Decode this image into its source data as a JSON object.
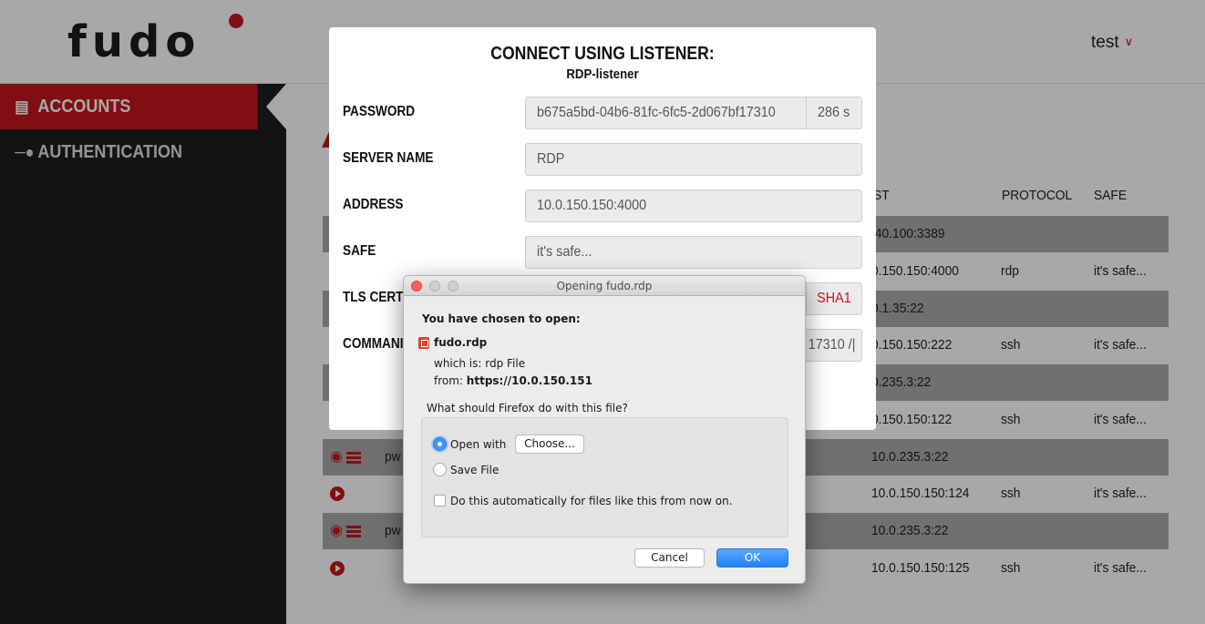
{
  "header": {
    "logo": "fudo",
    "user": "test"
  },
  "sidebar": {
    "items": [
      {
        "label": "ACCOUNTS",
        "active": true
      },
      {
        "label": "AUTHENTICATION",
        "active": false
      }
    ]
  },
  "table": {
    "headers": {
      "address": "ST",
      "protocol": "PROTOCOL",
      "safe": "SAFE"
    },
    "rows": [
      {
        "name": "",
        "address": ".40.100:3389",
        "protocol": "",
        "safe": "",
        "shade": true,
        "icons": ""
      },
      {
        "name": "",
        "address": "0.150.150:4000",
        "protocol": "rdp",
        "safe": "it's safe...",
        "shade": false,
        "icons": ""
      },
      {
        "name": "",
        "address": "0.1.35:22",
        "protocol": "",
        "safe": "",
        "shade": true,
        "icons": ""
      },
      {
        "name": "",
        "address": "0.150.150:222",
        "protocol": "ssh",
        "safe": "it's safe...",
        "shade": false,
        "icons": ""
      },
      {
        "name": "",
        "address": "0.235.3:22",
        "protocol": "",
        "safe": "",
        "shade": true,
        "icons": ""
      },
      {
        "name": "",
        "address": "0.150.150:122",
        "protocol": "ssh",
        "safe": "it's safe...",
        "shade": false,
        "icons": ""
      },
      {
        "name": "pw",
        "address": "10.0.235.3:22",
        "protocol": "",
        "safe": "",
        "shade": true,
        "icons": "view-list"
      },
      {
        "name": "",
        "address": "10.0.150.150:124",
        "protocol": "ssh",
        "safe": "it's safe...",
        "shade": false,
        "icons": "play"
      },
      {
        "name": "pw",
        "address": "10.0.235.3:22",
        "protocol": "",
        "safe": "",
        "shade": true,
        "icons": "view-list"
      },
      {
        "name": "",
        "address": "10.0.150.150:125",
        "protocol": "ssh",
        "safe": "it's safe...",
        "shade": false,
        "icons": "play"
      }
    ]
  },
  "modal": {
    "title": "CONNECT USING LISTENER:",
    "subtitle": "RDP-listener",
    "fields": {
      "password": {
        "label": "PASSWORD",
        "value": "b675a5bd-04b6-81fc-6fc5-2d067bf17310",
        "addon": "286 s"
      },
      "server_name": {
        "label": "SERVER NAME",
        "value": "RDP"
      },
      "address": {
        "label": "ADDRESS",
        "value": "10.0.150.150:4000"
      },
      "safe": {
        "label": "SAFE",
        "value": "it's safe..."
      },
      "tls": {
        "label": "TLS CERTI",
        "addon": "SHA1"
      },
      "command": {
        "label": "COMMANI",
        "value_tail": "17310 /|"
      }
    }
  },
  "ffdialog": {
    "title": "Opening fudo.rdp",
    "heading": "You have chosen to open:",
    "filename": "fudo.rdp",
    "which_is_label": "which is:",
    "which_is_value": "rdp File",
    "from_label": "from:",
    "from_value": "https://10.0.150.151",
    "question": "What should Firefox do with this file?",
    "open_with": "Open with",
    "choose": "Choose...",
    "save_file": "Save File",
    "auto": "Do this automatically for files like this from now on.",
    "cancel": "Cancel",
    "ok": "OK"
  },
  "colors": {
    "brand_red": "#c4161c",
    "sidebar_bg": "#1e1e21",
    "mac_blue": "#1f82f8"
  }
}
